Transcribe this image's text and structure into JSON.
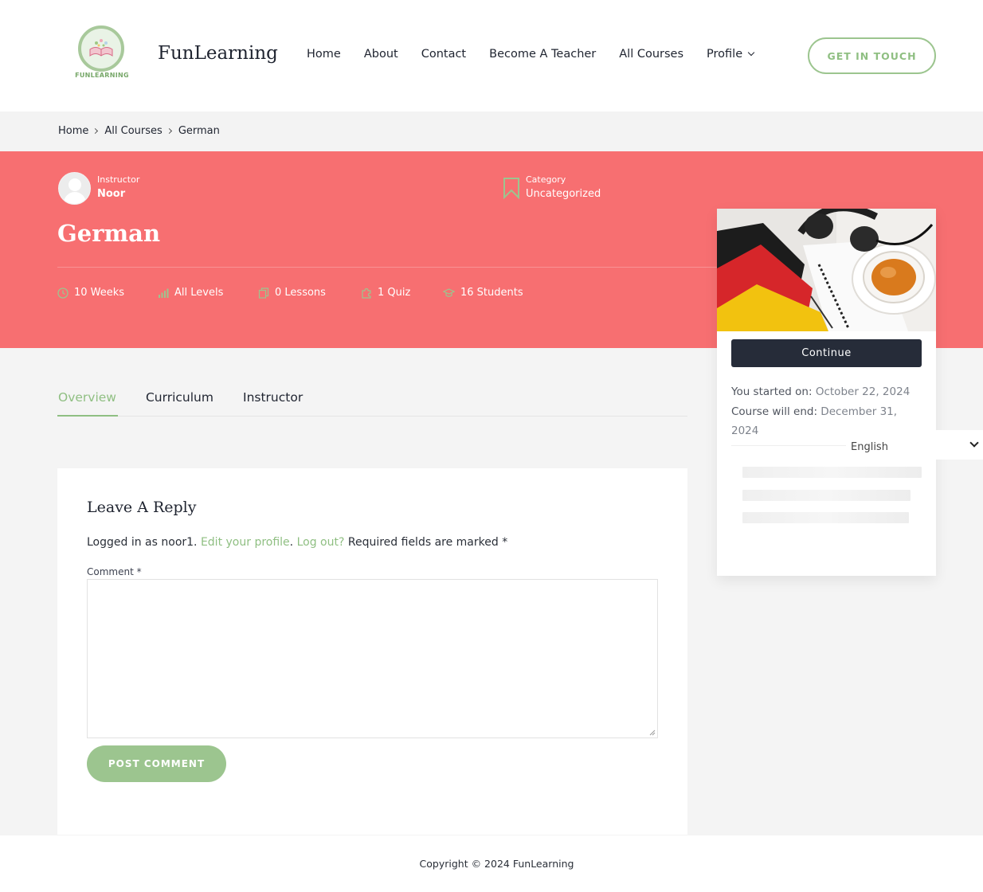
{
  "header": {
    "logo_text": "FUNLEARNING",
    "brand": "FunLearning",
    "nav": [
      "Home",
      "About",
      "Contact",
      "Become A Teacher",
      "All Courses",
      "Profile"
    ],
    "cta": "GET IN TOUCH"
  },
  "breadcrumb": [
    "Home",
    "All Courses",
    "German"
  ],
  "course": {
    "instructor_label": "Instructor",
    "instructor_name": "Noor",
    "category_label": "Category",
    "category_value": "Uncategorized",
    "title": "German",
    "stats": {
      "duration": "10 Weeks",
      "level": "All Levels",
      "lessons": "0 Lessons",
      "quiz": "1 Quiz",
      "students": "16 Students"
    }
  },
  "card": {
    "continue_label": "Continue",
    "started_label": "You started on:",
    "started_value": "October 22, 2024",
    "end_label": "Course will end:",
    "end_value": "December 31, 2024"
  },
  "language": "English",
  "tabs": [
    "Overview",
    "Curriculum",
    "Instructor"
  ],
  "reply": {
    "title": "Leave A Reply",
    "logged_prefix": "Logged in as noor1.",
    "edit_profile": "Edit your profile",
    "logout": "Log out?",
    "required": "Required fields are marked *",
    "comment_label": "Comment *",
    "post_label": "POST COMMENT"
  },
  "footer": {
    "copyright": "Copyright © 2024 FunLearning"
  },
  "colors": {
    "accent_green": "#8fbf82",
    "hero_red": "#f76f71",
    "dark_button": "#262c39"
  }
}
